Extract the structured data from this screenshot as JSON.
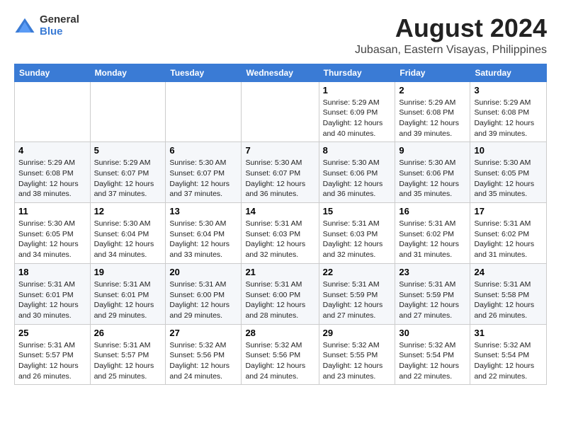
{
  "logo": {
    "general": "General",
    "blue": "Blue"
  },
  "title": "August 2024",
  "location": "Jubasan, Eastern Visayas, Philippines",
  "days_of_week": [
    "Sunday",
    "Monday",
    "Tuesday",
    "Wednesday",
    "Thursday",
    "Friday",
    "Saturday"
  ],
  "weeks": [
    [
      {
        "day": "",
        "info": ""
      },
      {
        "day": "",
        "info": ""
      },
      {
        "day": "",
        "info": ""
      },
      {
        "day": "",
        "info": ""
      },
      {
        "day": "1",
        "info": "Sunrise: 5:29 AM\nSunset: 6:09 PM\nDaylight: 12 hours and 40 minutes."
      },
      {
        "day": "2",
        "info": "Sunrise: 5:29 AM\nSunset: 6:08 PM\nDaylight: 12 hours and 39 minutes."
      },
      {
        "day": "3",
        "info": "Sunrise: 5:29 AM\nSunset: 6:08 PM\nDaylight: 12 hours and 39 minutes."
      }
    ],
    [
      {
        "day": "4",
        "info": "Sunrise: 5:29 AM\nSunset: 6:08 PM\nDaylight: 12 hours and 38 minutes."
      },
      {
        "day": "5",
        "info": "Sunrise: 5:29 AM\nSunset: 6:07 PM\nDaylight: 12 hours and 37 minutes."
      },
      {
        "day": "6",
        "info": "Sunrise: 5:30 AM\nSunset: 6:07 PM\nDaylight: 12 hours and 37 minutes."
      },
      {
        "day": "7",
        "info": "Sunrise: 5:30 AM\nSunset: 6:07 PM\nDaylight: 12 hours and 36 minutes."
      },
      {
        "day": "8",
        "info": "Sunrise: 5:30 AM\nSunset: 6:06 PM\nDaylight: 12 hours and 36 minutes."
      },
      {
        "day": "9",
        "info": "Sunrise: 5:30 AM\nSunset: 6:06 PM\nDaylight: 12 hours and 35 minutes."
      },
      {
        "day": "10",
        "info": "Sunrise: 5:30 AM\nSunset: 6:05 PM\nDaylight: 12 hours and 35 minutes."
      }
    ],
    [
      {
        "day": "11",
        "info": "Sunrise: 5:30 AM\nSunset: 6:05 PM\nDaylight: 12 hours and 34 minutes."
      },
      {
        "day": "12",
        "info": "Sunrise: 5:30 AM\nSunset: 6:04 PM\nDaylight: 12 hours and 34 minutes."
      },
      {
        "day": "13",
        "info": "Sunrise: 5:30 AM\nSunset: 6:04 PM\nDaylight: 12 hours and 33 minutes."
      },
      {
        "day": "14",
        "info": "Sunrise: 5:31 AM\nSunset: 6:03 PM\nDaylight: 12 hours and 32 minutes."
      },
      {
        "day": "15",
        "info": "Sunrise: 5:31 AM\nSunset: 6:03 PM\nDaylight: 12 hours and 32 minutes."
      },
      {
        "day": "16",
        "info": "Sunrise: 5:31 AM\nSunset: 6:02 PM\nDaylight: 12 hours and 31 minutes."
      },
      {
        "day": "17",
        "info": "Sunrise: 5:31 AM\nSunset: 6:02 PM\nDaylight: 12 hours and 31 minutes."
      }
    ],
    [
      {
        "day": "18",
        "info": "Sunrise: 5:31 AM\nSunset: 6:01 PM\nDaylight: 12 hours and 30 minutes."
      },
      {
        "day": "19",
        "info": "Sunrise: 5:31 AM\nSunset: 6:01 PM\nDaylight: 12 hours and 29 minutes."
      },
      {
        "day": "20",
        "info": "Sunrise: 5:31 AM\nSunset: 6:00 PM\nDaylight: 12 hours and 29 minutes."
      },
      {
        "day": "21",
        "info": "Sunrise: 5:31 AM\nSunset: 6:00 PM\nDaylight: 12 hours and 28 minutes."
      },
      {
        "day": "22",
        "info": "Sunrise: 5:31 AM\nSunset: 5:59 PM\nDaylight: 12 hours and 27 minutes."
      },
      {
        "day": "23",
        "info": "Sunrise: 5:31 AM\nSunset: 5:59 PM\nDaylight: 12 hours and 27 minutes."
      },
      {
        "day": "24",
        "info": "Sunrise: 5:31 AM\nSunset: 5:58 PM\nDaylight: 12 hours and 26 minutes."
      }
    ],
    [
      {
        "day": "25",
        "info": "Sunrise: 5:31 AM\nSunset: 5:57 PM\nDaylight: 12 hours and 26 minutes."
      },
      {
        "day": "26",
        "info": "Sunrise: 5:31 AM\nSunset: 5:57 PM\nDaylight: 12 hours and 25 minutes."
      },
      {
        "day": "27",
        "info": "Sunrise: 5:32 AM\nSunset: 5:56 PM\nDaylight: 12 hours and 24 minutes."
      },
      {
        "day": "28",
        "info": "Sunrise: 5:32 AM\nSunset: 5:56 PM\nDaylight: 12 hours and 24 minutes."
      },
      {
        "day": "29",
        "info": "Sunrise: 5:32 AM\nSunset: 5:55 PM\nDaylight: 12 hours and 23 minutes."
      },
      {
        "day": "30",
        "info": "Sunrise: 5:32 AM\nSunset: 5:54 PM\nDaylight: 12 hours and 22 minutes."
      },
      {
        "day": "31",
        "info": "Sunrise: 5:32 AM\nSunset: 5:54 PM\nDaylight: 12 hours and 22 minutes."
      }
    ]
  ]
}
